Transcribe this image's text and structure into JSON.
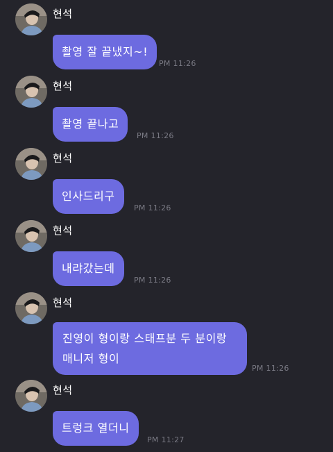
{
  "sender": {
    "name": "현석",
    "bubble_color": "#6d6be0"
  },
  "messages": [
    {
      "text": "촬영 잘 끝냈지~!",
      "time": "PM 11:26"
    },
    {
      "text": "촬영 끝나고",
      "time": "PM 11:26"
    },
    {
      "text": "인사드리구",
      "time": "PM 11:26"
    },
    {
      "text": "내랴갔는데",
      "time": "PM 11:26"
    },
    {
      "text": "진영이 형이랑 스태프분 두 분이랑 매니저 형이",
      "time": "PM 11:26"
    },
    {
      "text": "트렁크 열더니",
      "time": "PM 11:27"
    }
  ]
}
